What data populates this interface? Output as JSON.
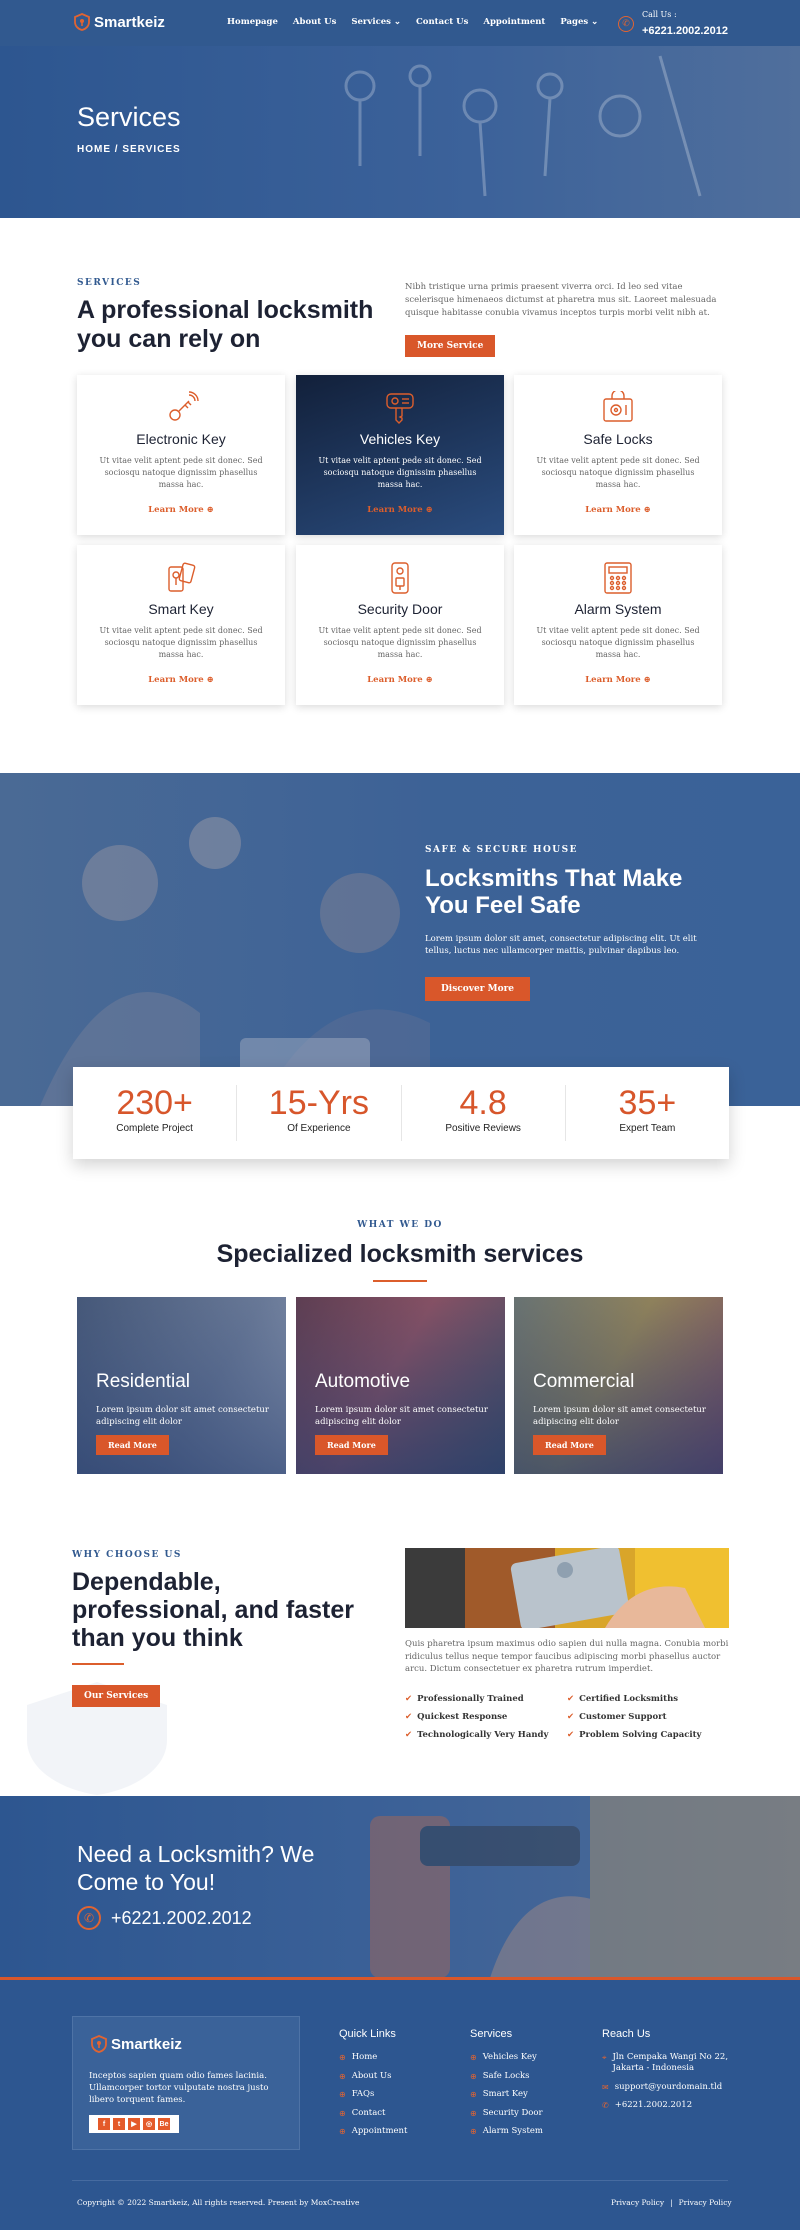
{
  "header": {
    "logo": "Smartkeiz",
    "nav": [
      "Homepage",
      "About Us",
      "Services",
      "Contact Us",
      "Appointment",
      "Pages"
    ],
    "active": "Services",
    "call_label": "Call Us :",
    "call_number": "+6221.2002.2012"
  },
  "hero": {
    "title": "Services",
    "breadcrumb": "HOME  /  SERVICES"
  },
  "intro": {
    "eyebrow": "SERVICES",
    "title": "A professional locksmith you can rely on",
    "text": "Nibh tristique urna primis praesent viverra orci. Id leo sed vitae scelerisque himenaeos dictumst at pharetra mus sit. Laoreet malesuada quisque habitasse conubia vivamus inceptos turpis morbi velit nibh at.",
    "button": "More Service"
  },
  "cards": [
    {
      "title": "Electronic Key",
      "text": "Ut vitae velit aptent pede sit donec. Sed sociosqu natoque dignissim phasellus massa hac.",
      "link": "Learn More"
    },
    {
      "title": "Vehicles Key",
      "text": "Ut vitae velit aptent pede sit donec. Sed sociosqu natoque dignissim phasellus massa hac.",
      "link": "Learn More"
    },
    {
      "title": "Safe Locks",
      "text": "Ut vitae velit aptent pede sit donec. Sed sociosqu natoque dignissim phasellus massa hac.",
      "link": "Learn More"
    },
    {
      "title": "Smart Key",
      "text": "Ut vitae velit aptent pede sit donec. Sed sociosqu natoque dignissim phasellus massa hac.",
      "link": "Learn More"
    },
    {
      "title": "Security Door",
      "text": "Ut vitae velit aptent pede sit donec. Sed sociosqu natoque dignissim phasellus massa hac.",
      "link": "Learn More"
    },
    {
      "title": "Alarm System",
      "text": "Ut vitae velit aptent pede sit donec. Sed sociosqu natoque dignissim phasellus massa hac.",
      "link": "Learn More"
    }
  ],
  "family": {
    "eyebrow": "SAFE & SECURE HOUSE",
    "title": "Locksmiths That Make You Feel Safe",
    "text": "Lorem ipsum dolor sit amet, consectetur adipiscing elit. Ut elit tellus, luctus nec ullamcorper mattis, pulvinar dapibus leo.",
    "button": "Discover More"
  },
  "stats": [
    {
      "num": "230+",
      "label": "Complete Project"
    },
    {
      "num": "15-Yrs",
      "label": "Of Experience"
    },
    {
      "num": "4.8",
      "label": "Positive Reviews"
    },
    {
      "num": "35+",
      "label": "Expert Team"
    }
  ],
  "what_we_do": {
    "eyebrow": "WHAT WE DO",
    "title": "Specialized locksmith services",
    "items": [
      {
        "title": "Residential",
        "text": "Lorem ipsum dolor sit amet consectetur adipiscing elit dolor",
        "button": "Read More"
      },
      {
        "title": "Automotive",
        "text": "Lorem ipsum dolor sit amet consectetur adipiscing elit dolor",
        "button": "Read More"
      },
      {
        "title": "Commercial",
        "text": "Lorem ipsum dolor sit amet consectetur adipiscing elit dolor",
        "button": "Read More"
      }
    ]
  },
  "why": {
    "eyebrow": "WHY CHOOSE US",
    "title": "Dependable, professional, and faster than you think",
    "button": "Our Services",
    "text": "Quis pharetra ipsum maximus odio sapien dui nulla magna. Conubia morbi ridiculus tellus neque tempor faucibus adipiscing morbi phasellus auctor arcu. Dictum consectetuer ex pharetra rutrum imperdiet.",
    "features": [
      "Professionally Trained",
      "Certified Locksmiths",
      "Quickest Response",
      "Customer Support",
      "Technologically Very Handy",
      "Problem Solving Capacity"
    ]
  },
  "cta": {
    "title": "Need a Locksmith? We Come to You!",
    "phone": "+6221.2002.2012"
  },
  "footer": {
    "logo": "Smartkeiz",
    "about": "Inceptos sapien quam odio fames lacinia. Ullamcorper tortor vulputate nostra justo libero torquent fames.",
    "quick_links_title": "Quick Links",
    "quick_links": [
      "Home",
      "About Us",
      "FAQs",
      "Contact",
      "Appointment"
    ],
    "services_title": "Services",
    "services": [
      "Vehicles Key",
      "Safe Locks",
      "Smart Key",
      "Security Door",
      "Alarm System"
    ],
    "reach_title": "Reach Us",
    "address": "Jln Cempaka Wangi No 22, Jakarta - Indonesia",
    "email": "support@yourdomain.tld",
    "phone": "+6221.2002.2012",
    "copyright": "Copyright © 2022 Smartkeiz, All rights reserved. Present by MoxCreative",
    "policies": [
      "Privacy Policy",
      "Privacy Policy"
    ]
  },
  "colors": {
    "primary": "#2f5891",
    "accent": "#dc5e2c"
  }
}
